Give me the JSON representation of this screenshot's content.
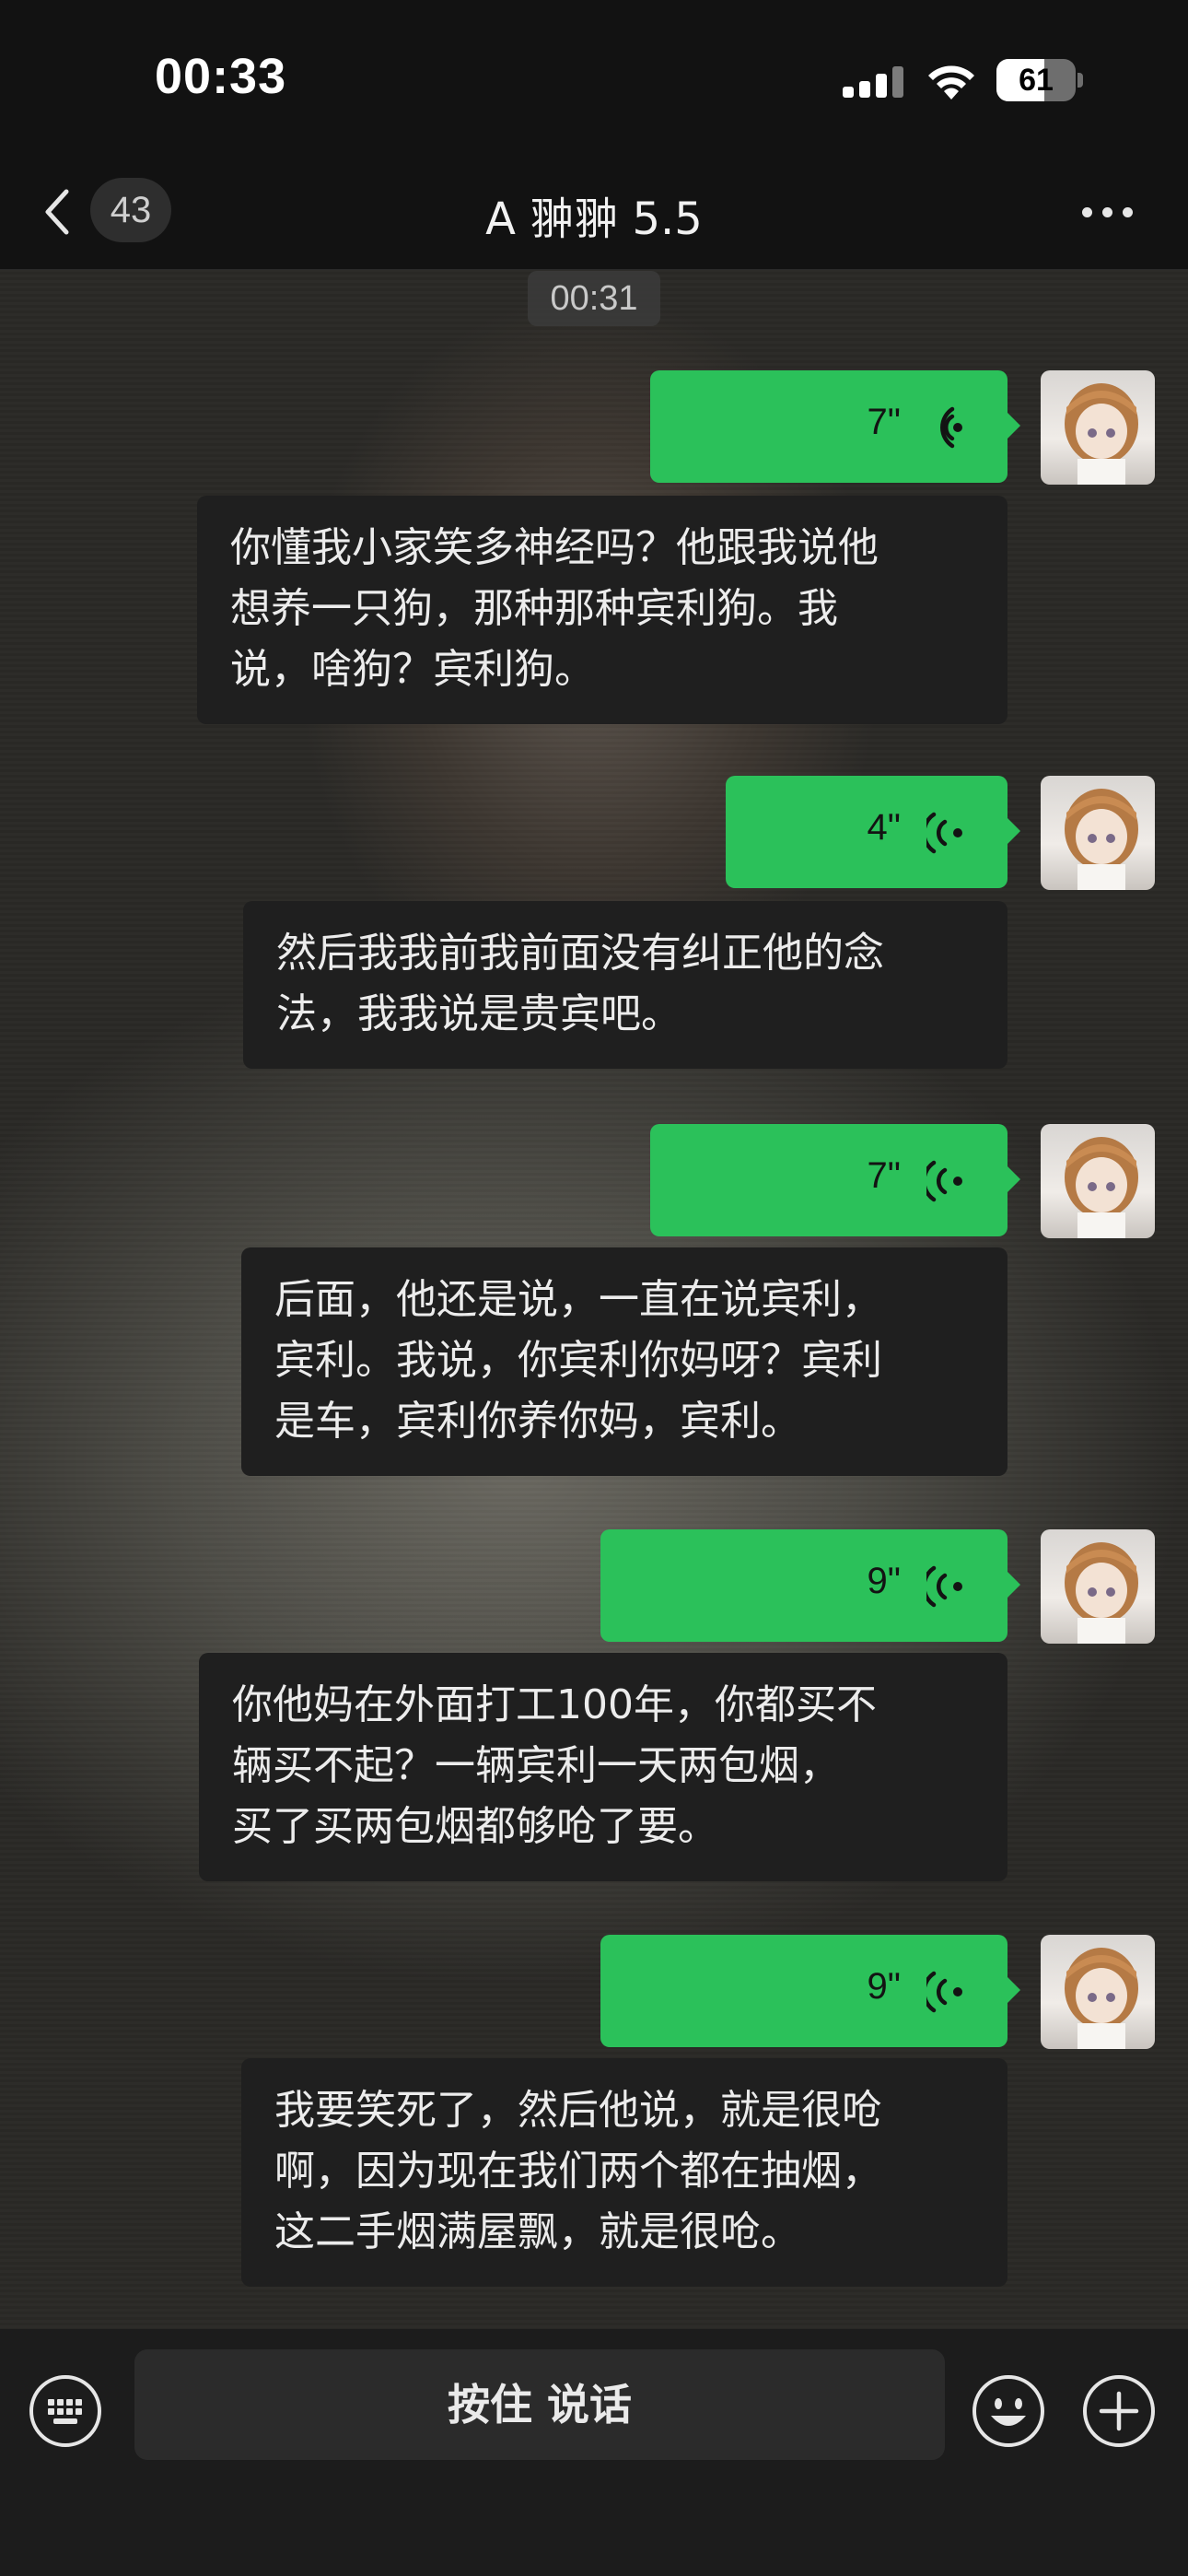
{
  "status_bar": {
    "time": "00:33",
    "battery": "61",
    "battery_level": 0.61
  },
  "nav": {
    "unread_count": "43",
    "title": "A 翀翀 5.5",
    "icons": [
      "back-icon",
      "more-icon"
    ]
  },
  "chat": {
    "timestamp": "00:31",
    "messages": [
      {
        "duration": "7\"",
        "transcript": [
          "你懂我小家笑多神经吗？他跟我说他",
          "想养一只狗，那种那种宾利狗。我",
          "说，啥狗？宾利狗。"
        ]
      },
      {
        "duration": "4\"",
        "transcript": [
          "然后我我前我前面没有纠正他的念",
          "法，我我说是贵宾吧。"
        ]
      },
      {
        "duration": "7\"",
        "transcript": [
          "后面，他还是说，一直在说宾利，",
          "宾利。我说，你宾利你妈呀？宾利",
          "是车，宾利你养你妈，宾利。"
        ]
      },
      {
        "duration": "9\"",
        "transcript": [
          "你他妈在外面打工100年，你都买不",
          "辆买不起？一辆宾利一天两包烟，",
          "买了买两包烟都够呛了要。"
        ]
      },
      {
        "duration": "9\"",
        "transcript": [
          "我要笑死了，然后他说，就是很呛",
          "啊，因为现在我们两个都在抽烟，",
          "这二手烟满屋飘，就是很呛。"
        ]
      }
    ]
  },
  "bottom_bar": {
    "hold_to_talk": "按住 说话",
    "icons": [
      "keyboard-icon",
      "emoji-icon",
      "plus-icon"
    ]
  },
  "colors": {
    "voice_bubble": "#2bc15a",
    "transcript_bubble": "#1f1f1f",
    "background": "#121212"
  }
}
